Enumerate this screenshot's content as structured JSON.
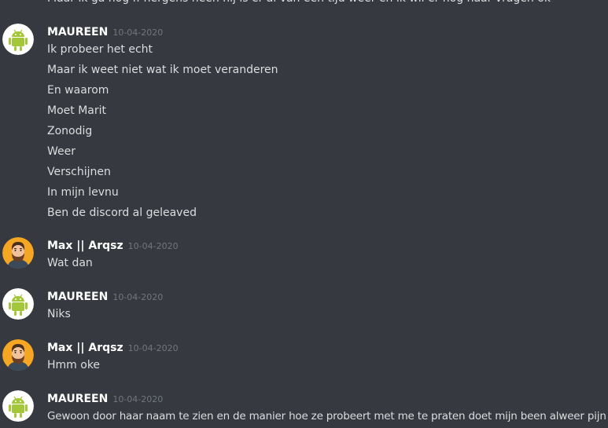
{
  "cutoff_text": "Maar ik ga nog ff nergens heen hij is er al van een tijd weer en ik wil er nog naar vragen ok",
  "messages": [
    {
      "username": "MAUREEN",
      "timestamp": "10-04-2020",
      "avatar": "android-avatar-icon",
      "lines": [
        "Ik probeer het echt",
        "Maar ik weet niet wat ik moet veranderen",
        "En waarom",
        "Moet Marit",
        "Zonodig",
        "Weer",
        "Verschijnen",
        "In mijn levnu",
        "Ben de discord al geleaved"
      ]
    },
    {
      "username": "Max || Arqsz",
      "timestamp": "10-04-2020",
      "avatar": "bearded-man-avatar-icon",
      "lines": [
        "Wat dan"
      ]
    },
    {
      "username": "MAUREEN",
      "timestamp": "10-04-2020",
      "avatar": "android-avatar-icon",
      "lines": [
        "Niks"
      ]
    },
    {
      "username": "Max || Arqsz",
      "timestamp": "10-04-2020",
      "avatar": "bearded-man-avatar-icon",
      "lines": [
        "Hmm oke"
      ]
    },
    {
      "username": "MAUREEN",
      "timestamp": "10-04-2020",
      "avatar": "android-avatar-icon",
      "lines": [
        "Gewoon door haar naam te zien en de manier hoe ze probeert met me te praten doet mijn been alweer pijn"
      ]
    }
  ],
  "colors": {
    "background": "#36393f",
    "username": "#ffffff",
    "timestamp": "#72767d",
    "text": "#dcddde",
    "android_green": "#a4c639",
    "avatar_orange": "#f5a623"
  }
}
